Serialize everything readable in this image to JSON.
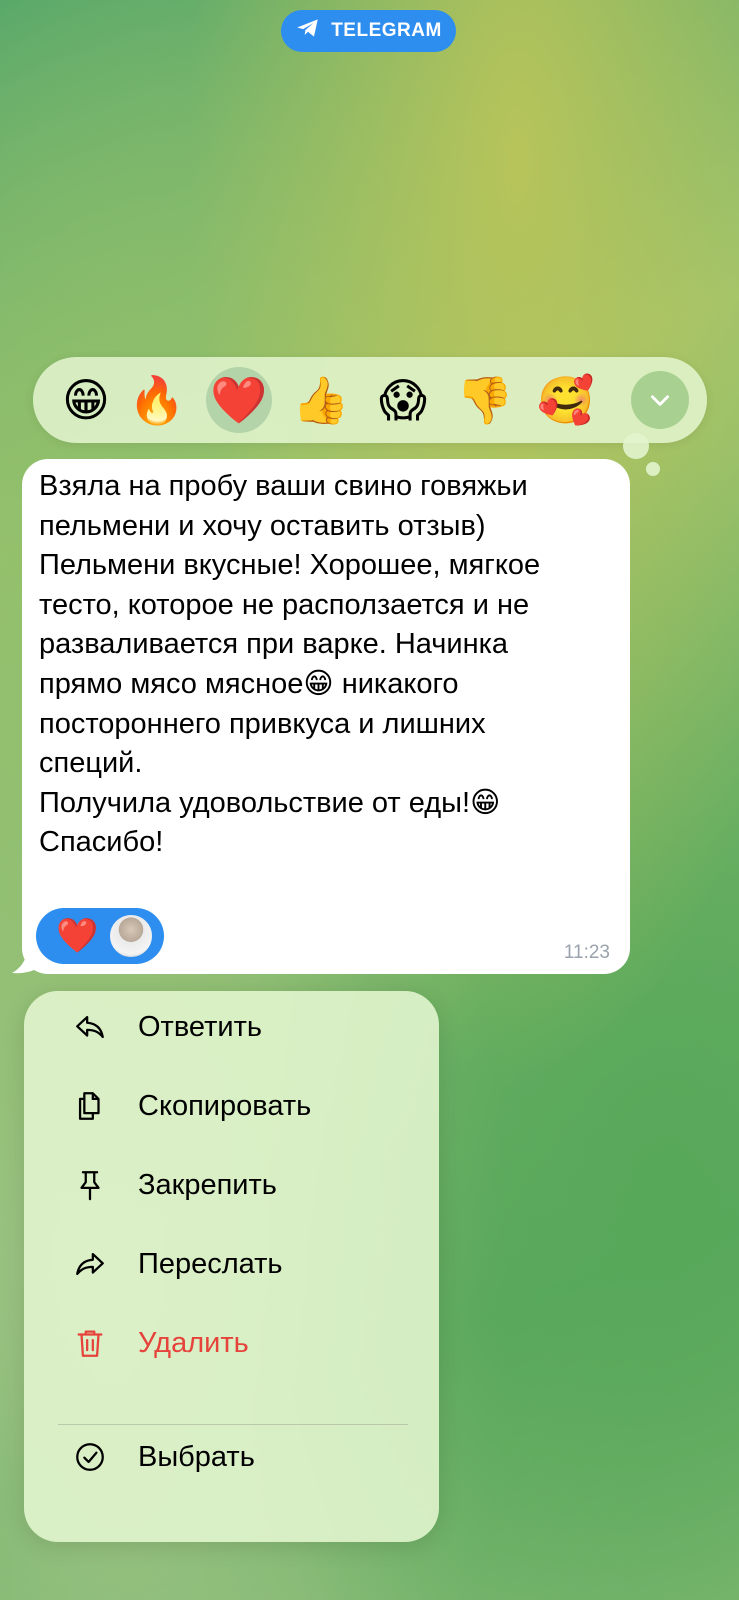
{
  "banner": {
    "label": "TELEGRAM",
    "icon": "telegram-icon",
    "color": "#2e8ef0"
  },
  "reaction_bar": {
    "reactions": [
      {
        "name": "grinning-face",
        "glyph": "😁",
        "selected": false
      },
      {
        "name": "fire",
        "glyph": "🔥",
        "selected": false
      },
      {
        "name": "red-heart",
        "glyph": "❤️",
        "selected": true
      },
      {
        "name": "thumbs-up",
        "glyph": "👍",
        "selected": false
      },
      {
        "name": "screaming-face",
        "glyph": "😱",
        "selected": false
      },
      {
        "name": "thumbs-down",
        "glyph": "👎",
        "selected": false
      },
      {
        "name": "smiling-face-with-hearts",
        "glyph": "🥰",
        "selected": false
      }
    ],
    "expand_icon": "chevron-down-icon"
  },
  "message": {
    "text": "Взяла на пробу ваши свино говяжьи\nпельмени и хочу оставить отзыв)\nПельмени вкусные! Хорошее, мягкое\nтесто, которое не расползается и не\nразваливается при варке. Начинка\nпрямо мясо мясное😁 никакого\nпостороннего привкуса и лишних\nспеций.\nПолучила удовольствие от еды!😁\nСпасибо!",
    "reaction": {
      "glyph": "❤️",
      "avatar": "user-avatar"
    },
    "time": "11:23"
  },
  "context_menu": {
    "items": [
      {
        "id": "reply",
        "label": "Ответить",
        "icon": "reply-icon",
        "danger": false
      },
      {
        "id": "copy",
        "label": "Скопировать",
        "icon": "copy-icon",
        "danger": false
      },
      {
        "id": "pin",
        "label": "Закрепить",
        "icon": "pin-icon",
        "danger": false
      },
      {
        "id": "forward",
        "label": "Переслать",
        "icon": "forward-icon",
        "danger": false
      },
      {
        "id": "delete",
        "label": "Удалить",
        "icon": "trash-icon",
        "danger": true
      },
      {
        "id": "select",
        "label": "Выбрать",
        "icon": "check-circle-icon",
        "danger": false
      }
    ],
    "danger_color": "#e5433b"
  }
}
